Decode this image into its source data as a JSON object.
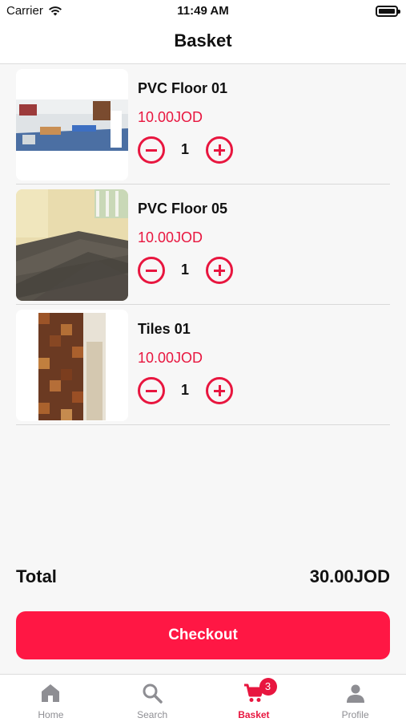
{
  "status_bar": {
    "carrier": "Carrier",
    "time": "11:49 AM"
  },
  "nav": {
    "title": "Basket"
  },
  "items": [
    {
      "name": "PVC Floor 01",
      "price": "10.00JOD",
      "quantity": "1"
    },
    {
      "name": "PVC Floor 05",
      "price": "10.00JOD",
      "quantity": "1"
    },
    {
      "name": "Tiles 01",
      "price": "10.00JOD",
      "quantity": "1"
    }
  ],
  "summary": {
    "total_label": "Total",
    "total_value": "30.00JOD"
  },
  "checkout": {
    "label": "Checkout"
  },
  "tabs": [
    {
      "label": "Home",
      "icon": "home-icon"
    },
    {
      "label": "Search",
      "icon": "search-icon"
    },
    {
      "label": "Basket",
      "icon": "cart-icon",
      "badge": "3",
      "active": true
    },
    {
      "label": "Profile",
      "icon": "person-icon"
    }
  ],
  "colors": {
    "accent": "#e8163f",
    "checkout_bg": "#ff1744",
    "inactive_tab": "#8e8e93"
  }
}
